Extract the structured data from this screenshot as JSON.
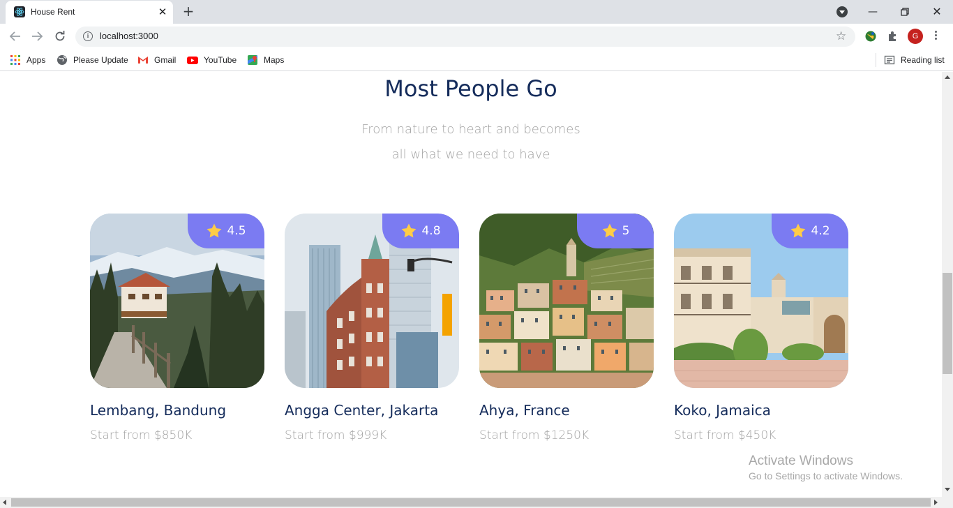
{
  "browser": {
    "tab_title": "House Rent",
    "url": "localhost:3000",
    "profile_initial": "G",
    "bookmarks": [
      "Apps",
      "Please Update",
      "Gmail",
      "YouTube",
      "Maps"
    ],
    "reading_list": "Reading list"
  },
  "section": {
    "title": "Most People Go",
    "subtitle_line1": "From nature to heart and becomes",
    "subtitle_line2": "all what we need to have"
  },
  "cards": [
    {
      "name": "Lembang, Bandung",
      "price": "Start from $850K",
      "rating": "4.5"
    },
    {
      "name": "Angga Center, Jakarta",
      "price": "Start from $999K",
      "rating": "4.8"
    },
    {
      "name": "Ahya, France",
      "price": "Start from $1250K",
      "rating": "5"
    },
    {
      "name": "Koko, Jamaica",
      "price": "Start from $450K",
      "rating": "4.2"
    }
  ],
  "watermark": {
    "line1": "Activate Windows",
    "line2": "Go to Settings to activate Windows."
  },
  "colors": {
    "accent": "#7b7bf2",
    "title": "#152c5b",
    "muted": "#a3a3a3",
    "star": "#ffcc47"
  }
}
